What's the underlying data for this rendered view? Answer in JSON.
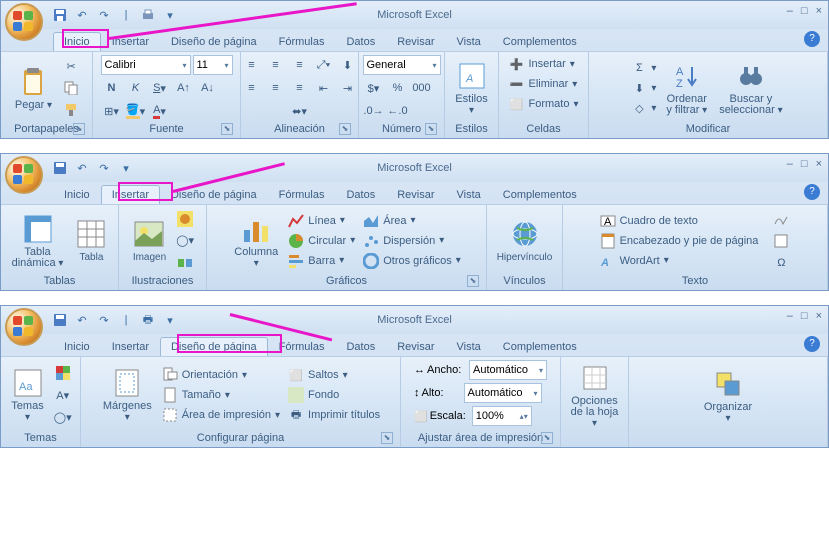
{
  "app_title": "Microsoft Excel",
  "tabs": [
    "Inicio",
    "Insertar",
    "Diseño de página",
    "Fórmulas",
    "Datos",
    "Revisar",
    "Vista",
    "Complementos"
  ],
  "window1": {
    "active_tab": "Inicio",
    "clipboard": {
      "label": "Portapapeles",
      "paste": "Pegar"
    },
    "font": {
      "label": "Fuente",
      "name": "Calibri",
      "size": "11"
    },
    "alignment": {
      "label": "Alineación"
    },
    "number": {
      "label": "Número",
      "format": "General"
    },
    "styles": {
      "label": "Estilos",
      "btn": "Estilos"
    },
    "cells": {
      "label": "Celdas",
      "insert": "Insertar",
      "delete": "Eliminar",
      "format": "Formato"
    },
    "editing": {
      "label": "Modificar",
      "sort": "Ordenar\ny filtrar",
      "find": "Buscar y\nseleccionar"
    }
  },
  "window2": {
    "active_tab": "Insertar",
    "tables": {
      "label": "Tablas",
      "pivot": "Tabla\ndinámica",
      "table": "Tabla"
    },
    "illustrations": {
      "label": "Ilustraciones",
      "image": "Imagen"
    },
    "charts": {
      "label": "Gráficos",
      "column": "Columna",
      "line": "Línea",
      "pie": "Circular",
      "bar": "Barra",
      "area": "Área",
      "scatter": "Dispersión",
      "other": "Otros gráficos"
    },
    "links": {
      "label": "Vínculos",
      "hyperlink": "Hipervínculo"
    },
    "text": {
      "label": "Texto",
      "textbox": "Cuadro de texto",
      "header": "Encabezado y pie de página",
      "wordart": "WordArt"
    }
  },
  "window3": {
    "active_tab": "Diseño de página",
    "themes": {
      "label": "Temas",
      "btn": "Temas"
    },
    "pagesetup": {
      "label": "Configurar página",
      "margins": "Márgenes",
      "orientation": "Orientación",
      "size": "Tamaño",
      "printarea": "Área de impresión",
      "breaks": "Saltos",
      "background": "Fondo",
      "titles": "Imprimir títulos"
    },
    "scalefit": {
      "label": "Ajustar área de impresión",
      "width": "Ancho:",
      "height": "Alto:",
      "scale": "Escala:",
      "auto": "Automático",
      "pct": "100%"
    },
    "sheetopts": {
      "label": "Opciones\nde la hoja"
    },
    "arrange": {
      "label": "Organizar"
    }
  }
}
